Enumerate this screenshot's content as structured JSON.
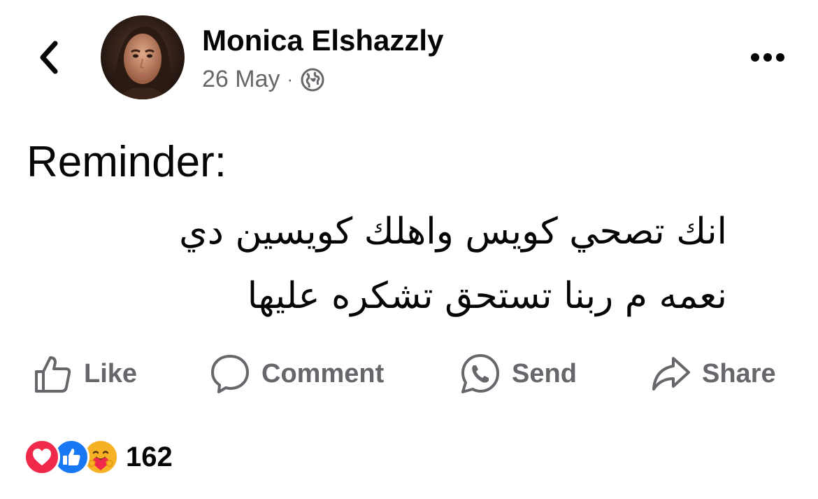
{
  "header": {
    "back_icon": "chevron-left-icon",
    "author_name": "Monica Elshazzly",
    "timestamp": "26 May",
    "separator": "·",
    "audience_icon": "globe-icon",
    "more_icon": "more-horizontal-icon"
  },
  "post": {
    "title": "Reminder:",
    "lines": [
      "انك تصحي كويس واهلك كويسين دي",
      "نعمه م ربنا تستحق تشكره عليها"
    ]
  },
  "actions": {
    "like": "Like",
    "comment": "Comment",
    "send": "Send",
    "share": "Share"
  },
  "reactions": {
    "icons": [
      "love-reaction-icon",
      "like-reaction-icon",
      "care-reaction-icon"
    ],
    "count": "162"
  },
  "colors": {
    "text_primary": "#050505",
    "text_secondary": "#65676b",
    "love": "#f0284a",
    "like": "#1877f2",
    "care": "#f7b125"
  }
}
